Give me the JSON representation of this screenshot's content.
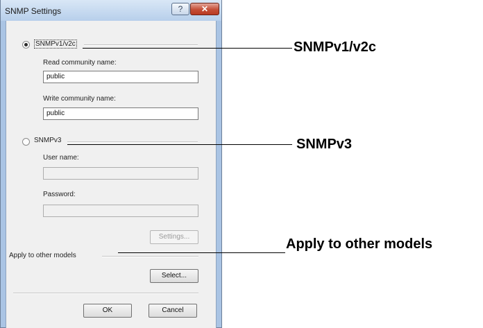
{
  "dialog": {
    "title": "SNMP Settings",
    "help_label": "?",
    "close_label": "✕"
  },
  "snmpv12": {
    "label": "SNMPv1/v2c",
    "read_label": "Read community name:",
    "read_value": "public",
    "write_label": "Write community name:",
    "write_value": "public"
  },
  "snmpv3": {
    "label": "SNMPv3",
    "user_label": "User name:",
    "user_value": "",
    "password_label": "Password:",
    "password_value": "",
    "settings_label": "Settings..."
  },
  "apply": {
    "label": "Apply to other models",
    "select_label": "Select..."
  },
  "footer": {
    "ok_label": "OK",
    "cancel_label": "Cancel"
  },
  "callouts": {
    "snmpv12": "SNMPv1/v2c",
    "snmpv3": "SNMPv3",
    "apply": "Apply to other models"
  }
}
